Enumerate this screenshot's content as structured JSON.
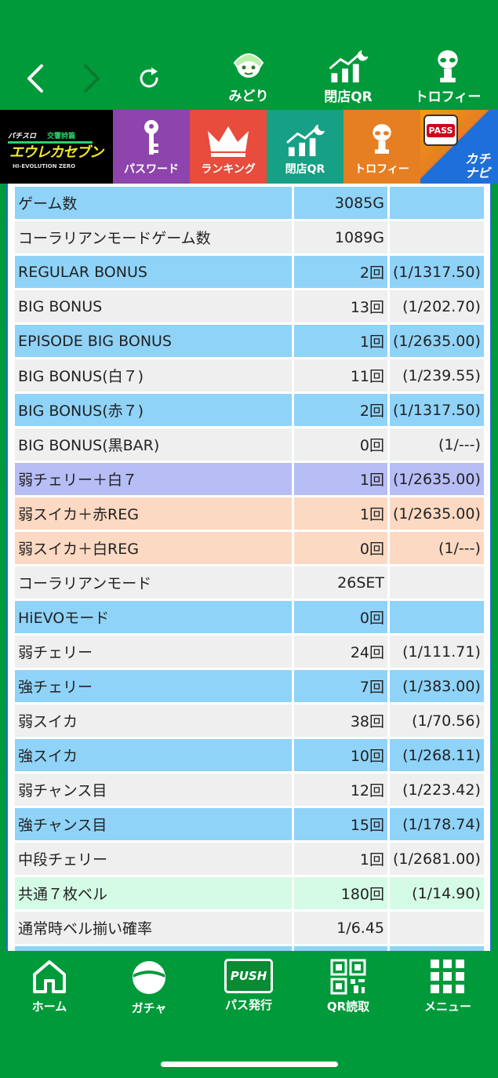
{
  "top_nav": {
    "back_icon": "chevron-left-icon",
    "forward_icon": "chevron-right-icon",
    "reload_icon": "reload-icon",
    "items": [
      {
        "label": "みどり",
        "icon": "character-icon"
      },
      {
        "label": "閉店QR",
        "icon": "chart-moon-icon"
      },
      {
        "label": "トロフィー",
        "icon": "trophy-alien-icon"
      }
    ]
  },
  "banner": {
    "logo_text": "エウレカセブン",
    "logo_sub": "HI-EVOLUTION ZERO",
    "tiles": [
      {
        "label": "パスワード",
        "icon": "key-icon",
        "color": "#8e44ad"
      },
      {
        "label": "ランキング",
        "icon": "crown-icon",
        "color": "#e74c3c"
      },
      {
        "label": "閉店QR",
        "icon": "chart-moon-icon",
        "color": "#16a085"
      },
      {
        "label": "トロフィー",
        "icon": "trophy-alien-icon",
        "color": "#e67e22"
      },
      {
        "label": "カチナビ",
        "badge": "PASS",
        "color": "#1e6fd9"
      }
    ]
  },
  "stats": {
    "rows": [
      {
        "name": "ゲーム数",
        "count": "3085G",
        "prob": "",
        "bg": "#8fd3f8"
      },
      {
        "name": "コーラリアンモードゲーム数",
        "count": "1089G",
        "prob": "",
        "bg": "#efefef"
      },
      {
        "name": "REGULAR BONUS",
        "count": "2回",
        "prob": "(1/1317.50)",
        "bg": "#8fd3f8"
      },
      {
        "name": "BIG BONUS",
        "count": "13回",
        "prob": "(1/202.70)",
        "bg": "#efefef"
      },
      {
        "name": "EPISODE BIG BONUS",
        "count": "1回",
        "prob": "(1/2635.00)",
        "bg": "#8fd3f8"
      },
      {
        "name": "BIG BONUS(白７)",
        "count": "11回",
        "prob": "(1/239.55)",
        "bg": "#efefef"
      },
      {
        "name": "BIG BONUS(赤７)",
        "count": "2回",
        "prob": "(1/1317.50)",
        "bg": "#8fd3f8"
      },
      {
        "name": "BIG BONUS(黒BAR)",
        "count": "0回",
        "prob": "(1/---)",
        "bg": "#efefef"
      },
      {
        "name": "弱チェリー＋白７",
        "count": "1回",
        "prob": "(1/2635.00)",
        "bg": "#b7bdf5"
      },
      {
        "name": "弱スイカ＋赤REG",
        "count": "1回",
        "prob": "(1/2635.00)",
        "bg": "#fcd9c2"
      },
      {
        "name": "弱スイカ＋白REG",
        "count": "0回",
        "prob": "(1/---)",
        "bg": "#fcd9c2"
      },
      {
        "name": "コーラリアンモード",
        "count": "26SET",
        "prob": "",
        "bg": "#efefef"
      },
      {
        "name": "HiEVOモード",
        "count": "0回",
        "prob": "",
        "bg": "#8fd3f8"
      },
      {
        "name": "弱チェリー",
        "count": "24回",
        "prob": "(1/111.71)",
        "bg": "#efefef"
      },
      {
        "name": "強チェリー",
        "count": "7回",
        "prob": "(1/383.00)",
        "bg": "#8fd3f8"
      },
      {
        "name": "弱スイカ",
        "count": "38回",
        "prob": "(1/70.56)",
        "bg": "#efefef"
      },
      {
        "name": "強スイカ",
        "count": "10回",
        "prob": "(1/268.11)",
        "bg": "#8fd3f8"
      },
      {
        "name": "弱チャンス目",
        "count": "12回",
        "prob": "(1/223.42)",
        "bg": "#efefef"
      },
      {
        "name": "強チャンス目",
        "count": "15回",
        "prob": "(1/178.74)",
        "bg": "#8fd3f8"
      },
      {
        "name": "中段チェリー",
        "count": "1回",
        "prob": "(1/2681.00)",
        "bg": "#efefef"
      },
      {
        "name": "共通７枚ベル",
        "count": "180回",
        "prob": "(1/14.90)",
        "bg": "#d4fbe6"
      },
      {
        "name": "通常時ベル揃い確率",
        "count": "1/6.45",
        "prob": "",
        "bg": "#efefef"
      },
      {
        "name": "",
        "count": "",
        "prob": "",
        "bg": "#8fd3f8"
      }
    ]
  },
  "bottom_nav": {
    "tabs": [
      {
        "label": "ホーム",
        "icon": "home-icon"
      },
      {
        "label": "ガチャ",
        "icon": "gacha-icon"
      },
      {
        "label": "パス発行",
        "icon": "push-icon",
        "badge": "PUSH"
      },
      {
        "label": "QR読取",
        "icon": "qr-icon"
      },
      {
        "label": "メニュー",
        "icon": "grid-menu-icon"
      }
    ]
  }
}
